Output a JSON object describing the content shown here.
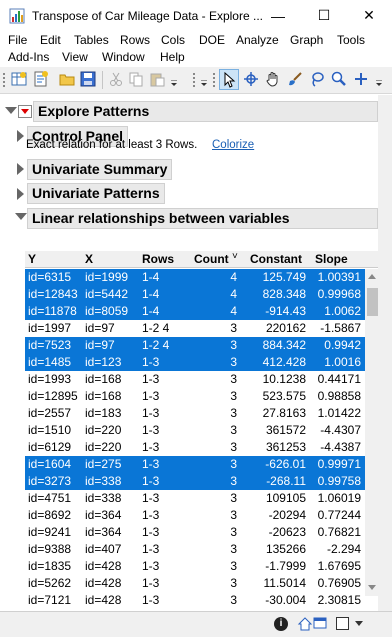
{
  "window": {
    "title": "Transpose of Car Mileage Data - Explore ...",
    "minimize": "—",
    "maximize": "☐",
    "close": "✕"
  },
  "menu": [
    "File",
    "Edit",
    "Tables",
    "Rows",
    "Cols",
    "DOE",
    "Analyze",
    "Graph",
    "Tools",
    "Add-Ins",
    "View",
    "Window",
    "Help"
  ],
  "toolbar_icons": [
    "new-data-table-icon",
    "new-script-icon",
    "open-icon",
    "save-icon",
    "cut-icon",
    "copy-icon",
    "paste-icon",
    "arrow-tool-icon",
    "crosshair-tool-icon",
    "hand-tool-icon",
    "brush-tool-icon",
    "lasso-tool-icon",
    "magnifier-tool-icon",
    "plus-tool-icon"
  ],
  "report": {
    "title": "Explore Patterns",
    "sections": {
      "control_panel": "Control Panel",
      "univariate_summary": "Univariate Summary",
      "univariate_patterns": "Univariate Patterns",
      "linear": "Linear relationships between variables"
    },
    "note": "Exact relation for at least 3 Rows.",
    "colorize": "Colorize",
    "table": {
      "headers": [
        "Y",
        "X",
        "Rows",
        "Count",
        "Constant",
        "Slope"
      ],
      "sort_indicator": "˅",
      "rows": [
        {
          "y": "id=6315",
          "x": "id=1999",
          "rows": "1-4",
          "count": "4",
          "constant": "125.749",
          "slope": "1.00391",
          "selected": true
        },
        {
          "y": "id=12843",
          "x": "id=5442",
          "rows": "1-4",
          "count": "4",
          "constant": "828.348",
          "slope": "0.99968",
          "selected": true
        },
        {
          "y": "id=11878",
          "x": "id=8059",
          "rows": "1-4",
          "count": "4",
          "constant": "-914.43",
          "slope": "1.0062",
          "selected": true
        },
        {
          "y": "id=1997",
          "x": "id=97",
          "rows": "1-2 4",
          "count": "3",
          "constant": "220162",
          "slope": "-1.5867",
          "selected": false
        },
        {
          "y": "id=7523",
          "x": "id=97",
          "rows": "1-2 4",
          "count": "3",
          "constant": "884.342",
          "slope": "0.9942",
          "selected": true
        },
        {
          "y": "id=1485",
          "x": "id=123",
          "rows": "1-3",
          "count": "3",
          "constant": "412.428",
          "slope": "1.0016",
          "selected": true
        },
        {
          "y": "id=1993",
          "x": "id=168",
          "rows": "1-3",
          "count": "3",
          "constant": "10.1238",
          "slope": "0.44171",
          "selected": false
        },
        {
          "y": "id=12895",
          "x": "id=168",
          "rows": "1-3",
          "count": "3",
          "constant": "523.575",
          "slope": "0.98858",
          "selected": false
        },
        {
          "y": "id=2557",
          "x": "id=183",
          "rows": "1-3",
          "count": "3",
          "constant": "27.8163",
          "slope": "1.01422",
          "selected": false
        },
        {
          "y": "id=1510",
          "x": "id=220",
          "rows": "1-3",
          "count": "3",
          "constant": "361572",
          "slope": "-4.4307",
          "selected": false
        },
        {
          "y": "id=6129",
          "x": "id=220",
          "rows": "1-3",
          "count": "3",
          "constant": "361253",
          "slope": "-4.4387",
          "selected": false
        },
        {
          "y": "id=1604",
          "x": "id=275",
          "rows": "1-3",
          "count": "3",
          "constant": "-626.01",
          "slope": "0.99971",
          "selected": true
        },
        {
          "y": "id=3273",
          "x": "id=338",
          "rows": "1-3",
          "count": "3",
          "constant": "-268.11",
          "slope": "0.99758",
          "selected": true
        },
        {
          "y": "id=4751",
          "x": "id=338",
          "rows": "1-3",
          "count": "3",
          "constant": "109105",
          "slope": "1.06019",
          "selected": false
        },
        {
          "y": "id=8692",
          "x": "id=364",
          "rows": "1-3",
          "count": "3",
          "constant": "-20294",
          "slope": "0.77244",
          "selected": false
        },
        {
          "y": "id=9241",
          "x": "id=364",
          "rows": "1-3",
          "count": "3",
          "constant": "-20623",
          "slope": "0.76821",
          "selected": false
        },
        {
          "y": "id=9388",
          "x": "id=407",
          "rows": "1-3",
          "count": "3",
          "constant": "135266",
          "slope": "-2.294",
          "selected": false
        },
        {
          "y": "id=1835",
          "x": "id=428",
          "rows": "1-3",
          "count": "3",
          "constant": "-1.7999",
          "slope": "1.67695",
          "selected": false
        },
        {
          "y": "id=5262",
          "x": "id=428",
          "rows": "1-3",
          "count": "3",
          "constant": "11.5014",
          "slope": "0.76905",
          "selected": false
        },
        {
          "y": "id=7121",
          "x": "id=428",
          "rows": "1-3",
          "count": "3",
          "constant": "-30.004",
          "slope": "2.30815",
          "selected": false
        }
      ]
    }
  },
  "colors": {
    "selection": "#0a76d6",
    "link": "#1a5fb4",
    "red_triangle": "#dd0000"
  }
}
